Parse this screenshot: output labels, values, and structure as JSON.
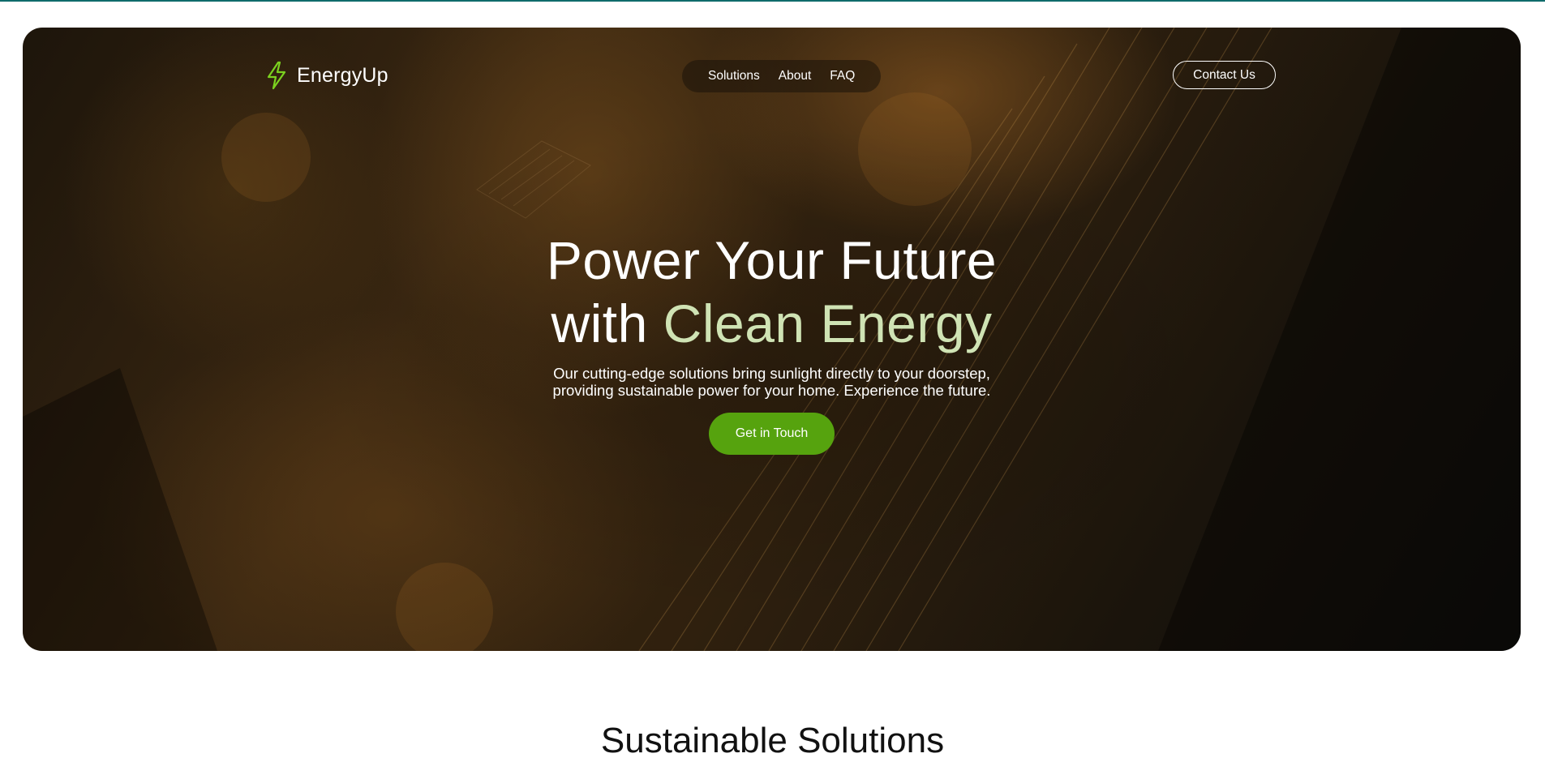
{
  "brand": {
    "name": "EnergyUp",
    "logo_icon": "lightning-bolt-icon",
    "accent_color": "#7bd11f"
  },
  "nav": {
    "items": [
      {
        "label": "Solutions"
      },
      {
        "label": "About"
      },
      {
        "label": "FAQ"
      }
    ],
    "contact_label": "Contact Us"
  },
  "hero": {
    "headline_line1": "Power Your Future",
    "headline_line2_prefix": "with ",
    "headline_line2_accent": "Clean Energy",
    "accent_text_color": "#cfe3b4",
    "subtext_line1": "Our cutting-edge solutions bring sunlight directly to your doorstep,",
    "subtext_line2": "providing sustainable power for your home. Experience the future.",
    "cta_label": "Get in Touch",
    "cta_color": "#56a30e"
  },
  "next_section": {
    "title": "Sustainable Solutions"
  }
}
